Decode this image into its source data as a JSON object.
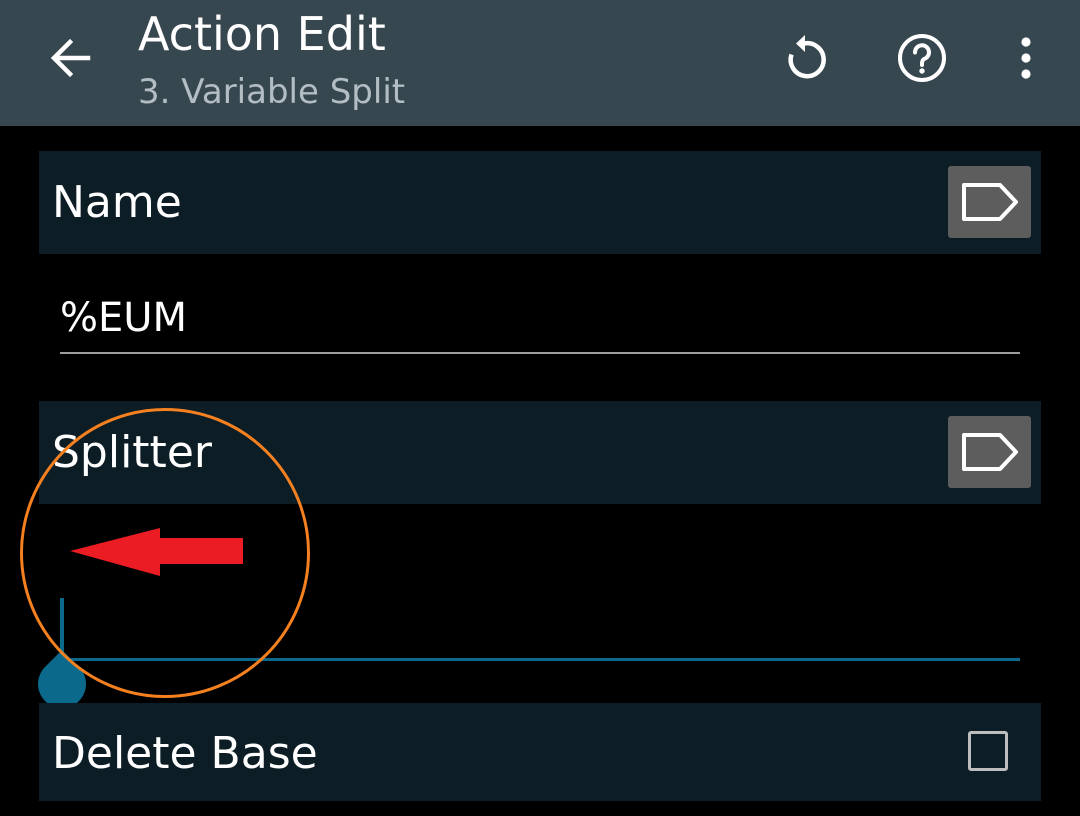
{
  "appbar": {
    "title": "Action Edit",
    "subtitle": "3. Variable Split",
    "back_icon": "arrow-back-icon",
    "reset_icon": "reset-icon",
    "help_icon": "help-icon",
    "more_icon": "more-vert-icon",
    "background": "#37474f"
  },
  "fields": {
    "name": {
      "label": "Name",
      "value": "%EUM",
      "tag_icon": "label-tag-icon"
    },
    "splitter": {
      "label": "Splitter",
      "value": "",
      "tag_icon": "label-tag-icon",
      "focused": true
    },
    "delete_base": {
      "label": "Delete Base",
      "checked": false
    }
  },
  "colors": {
    "accent": "#0b6a8c",
    "section_bg": "#0d1d26",
    "annotation_circle": "#f5801f",
    "annotation_arrow": "#ec1c24"
  }
}
